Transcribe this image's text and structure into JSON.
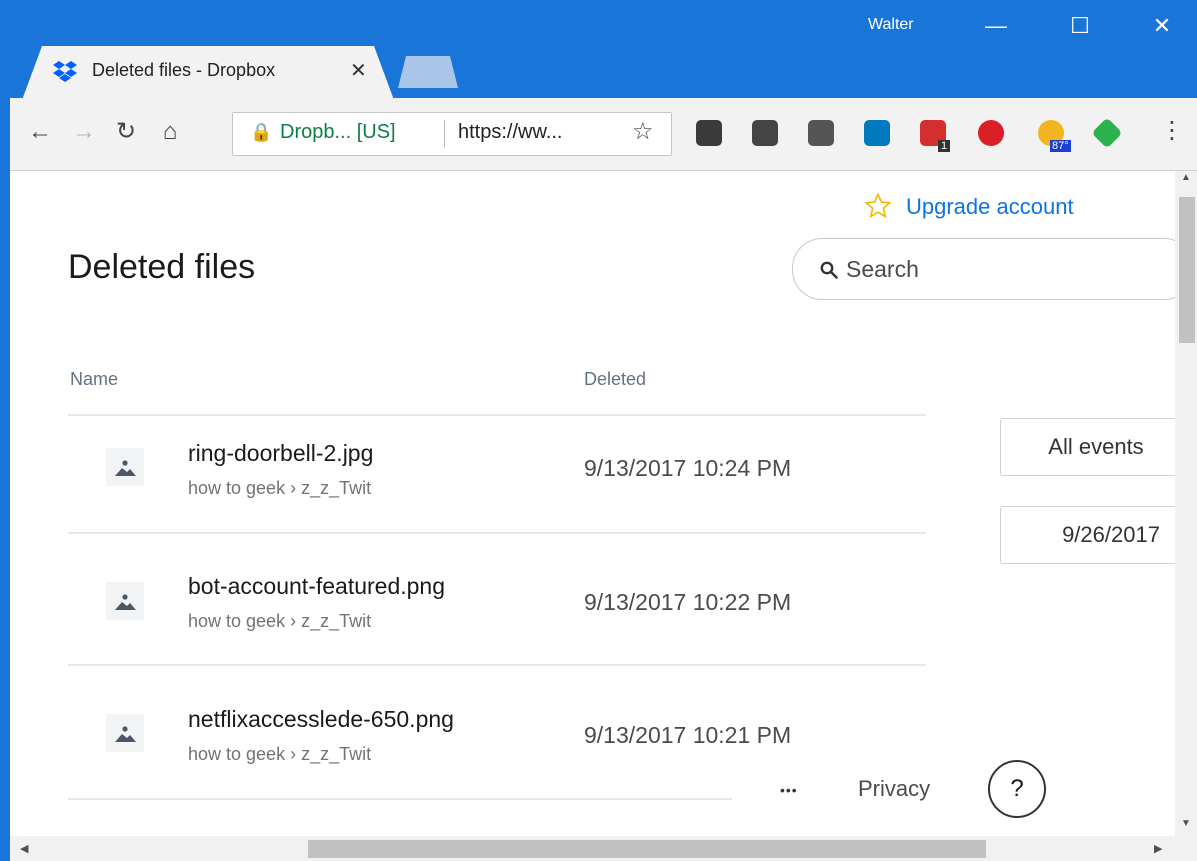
{
  "browser": {
    "user": "Walter",
    "tab_title": "Deleted files - Dropbox",
    "address_site": "Dropb... [US]",
    "address_url": "https://ww...",
    "extensions": [
      {
        "name": "pocket",
        "color": "#3a3a3a"
      },
      {
        "name": "bulb",
        "color": "#444444"
      },
      {
        "name": "mail",
        "color": "#555555"
      },
      {
        "name": "trello",
        "color": "#0079bf"
      },
      {
        "name": "calendar",
        "color": "#d32f2f",
        "badge": "1"
      },
      {
        "name": "creative-cloud",
        "color": "#da1f26"
      },
      {
        "name": "weather",
        "color": "#f3b51f",
        "badge": "87°"
      },
      {
        "name": "feedly",
        "color": "#2bb24c"
      }
    ]
  },
  "page": {
    "upgrade_link": "Upgrade account",
    "title": "Deleted files",
    "search_placeholder": "Search",
    "columns": {
      "name": "Name",
      "deleted": "Deleted"
    },
    "files": [
      {
        "name": "ring-doorbell-2.jpg",
        "path_root": "how to geek",
        "path_sep": "›",
        "path_child": "z_z_Twit",
        "deleted": "9/13/2017 10:24 PM"
      },
      {
        "name": "bot-account-featured.png",
        "path_root": "how to geek",
        "path_sep": "›",
        "path_child": "z_z_Twit",
        "deleted": "9/13/2017 10:22 PM"
      },
      {
        "name": "netflixaccesslede-650.png",
        "path_root": "how to geek",
        "path_sep": "›",
        "path_child": "z_z_Twit",
        "deleted": "9/13/2017 10:21 PM"
      }
    ],
    "filter_events": "All events",
    "filter_date": "9/26/2017",
    "footer": {
      "more": "•••",
      "privacy": "Privacy",
      "help": "?"
    }
  },
  "colors": {
    "chrome_blue": "#1975d8",
    "link_blue": "#0d74e8",
    "star": "#f5b800"
  }
}
